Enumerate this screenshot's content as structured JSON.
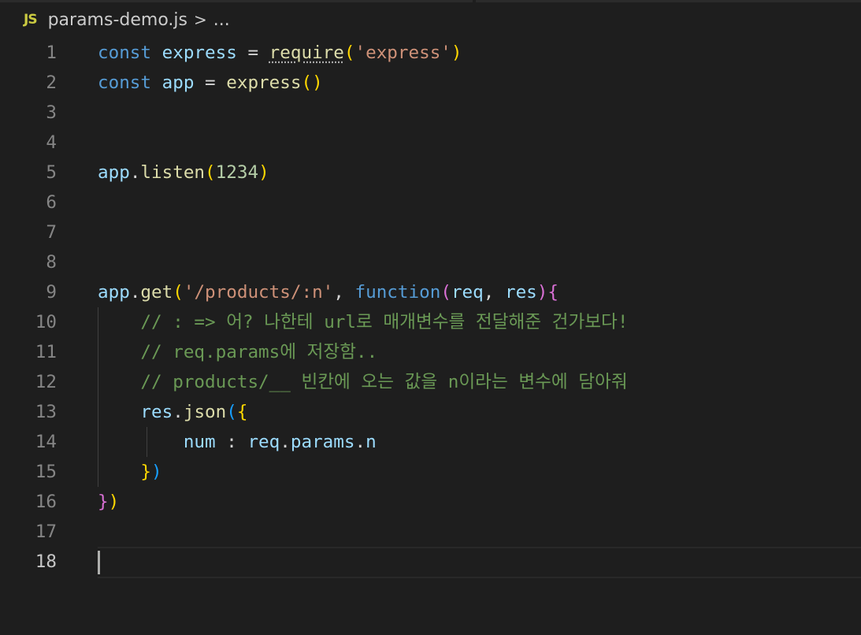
{
  "breadcrumb": {
    "file_icon": "JS",
    "file_name": "params-demo.js",
    "separator": ">",
    "more": "..."
  },
  "colors": {
    "background": "#1e1e1e",
    "keyword": "#569cd6",
    "variable": "#9cdcfe",
    "function": "#dcdcaa",
    "string": "#ce9178",
    "number": "#b5cea8",
    "comment": "#6a9955",
    "bracket_gold": "#ffd700",
    "bracket_purple": "#da70d6",
    "bracket_blue": "#179fff"
  },
  "editor": {
    "active_line": 18,
    "lines": [
      {
        "n": "1",
        "tokens": [
          {
            "t": "const",
            "c": "kw"
          },
          {
            "t": " "
          },
          {
            "t": "express",
            "c": "var"
          },
          {
            "t": " = "
          },
          {
            "t": "require",
            "c": "fn dotted"
          },
          {
            "t": "(",
            "c": "p1"
          },
          {
            "t": "'express'",
            "c": "str"
          },
          {
            "t": ")",
            "c": "p1"
          }
        ]
      },
      {
        "n": "2",
        "tokens": [
          {
            "t": "const",
            "c": "kw"
          },
          {
            "t": " "
          },
          {
            "t": "app",
            "c": "var"
          },
          {
            "t": " = "
          },
          {
            "t": "express",
            "c": "fn"
          },
          {
            "t": "()",
            "c": "p1"
          }
        ]
      },
      {
        "n": "3",
        "tokens": []
      },
      {
        "n": "4",
        "tokens": []
      },
      {
        "n": "5",
        "tokens": [
          {
            "t": "app",
            "c": "var"
          },
          {
            "t": "."
          },
          {
            "t": "listen",
            "c": "fn"
          },
          {
            "t": "(",
            "c": "p1"
          },
          {
            "t": "1234",
            "c": "num"
          },
          {
            "t": ")",
            "c": "p1"
          }
        ]
      },
      {
        "n": "6",
        "tokens": []
      },
      {
        "n": "7",
        "tokens": []
      },
      {
        "n": "8",
        "tokens": []
      },
      {
        "n": "9",
        "tokens": [
          {
            "t": "app",
            "c": "var"
          },
          {
            "t": "."
          },
          {
            "t": "get",
            "c": "fn"
          },
          {
            "t": "(",
            "c": "p1"
          },
          {
            "t": "'/products/:n'",
            "c": "str"
          },
          {
            "t": ", "
          },
          {
            "t": "function",
            "c": "kw"
          },
          {
            "t": "(",
            "c": "p2"
          },
          {
            "t": "req",
            "c": "var"
          },
          {
            "t": ", "
          },
          {
            "t": "res",
            "c": "var"
          },
          {
            "t": ")",
            "c": "p2"
          },
          {
            "t": "{",
            "c": "p2"
          }
        ]
      },
      {
        "n": "10",
        "tokens": [
          {
            "t": "    "
          },
          {
            "t": "// : => 어? 나한테 url로 매개변수를 전달해준 건가보다!",
            "c": "cm"
          }
        ]
      },
      {
        "n": "11",
        "tokens": [
          {
            "t": "    "
          },
          {
            "t": "// req.params에 저장함..",
            "c": "cm"
          }
        ]
      },
      {
        "n": "12",
        "tokens": [
          {
            "t": "    "
          },
          {
            "t": "// products/__ 빈칸에 오는 값을 n이라는 변수에 담아줘",
            "c": "cm"
          }
        ]
      },
      {
        "n": "13",
        "tokens": [
          {
            "t": "    "
          },
          {
            "t": "res",
            "c": "var"
          },
          {
            "t": "."
          },
          {
            "t": "json",
            "c": "fn"
          },
          {
            "t": "(",
            "c": "p3"
          },
          {
            "t": "{",
            "c": "p1"
          }
        ]
      },
      {
        "n": "14",
        "tokens": [
          {
            "t": "        "
          },
          {
            "t": "num",
            "c": "var"
          },
          {
            "t": " : "
          },
          {
            "t": "req",
            "c": "var"
          },
          {
            "t": "."
          },
          {
            "t": "params",
            "c": "var"
          },
          {
            "t": "."
          },
          {
            "t": "n",
            "c": "var"
          }
        ]
      },
      {
        "n": "15",
        "tokens": [
          {
            "t": "    "
          },
          {
            "t": "}",
            "c": "p1"
          },
          {
            "t": ")",
            "c": "p3"
          }
        ]
      },
      {
        "n": "16",
        "tokens": [
          {
            "t": "}",
            "c": "p2"
          },
          {
            "t": ")",
            "c": "p1"
          }
        ]
      },
      {
        "n": "17",
        "tokens": []
      },
      {
        "n": "18",
        "tokens": []
      }
    ]
  }
}
